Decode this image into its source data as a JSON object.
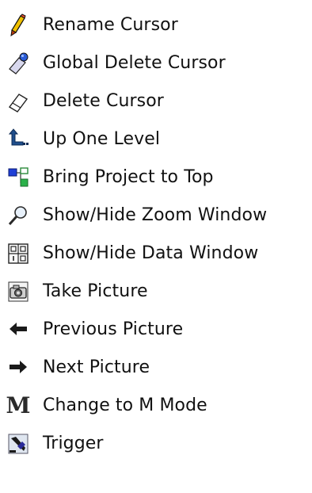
{
  "items": [
    {
      "icon": "pencil-icon",
      "label": "Rename Cursor"
    },
    {
      "icon": "global-delete-cursor-icon",
      "label": "Global Delete Cursor"
    },
    {
      "icon": "eraser-icon",
      "label": "Delete Cursor"
    },
    {
      "icon": "up-one-level-icon",
      "label": "Up One Level"
    },
    {
      "icon": "bring-project-to-top-icon",
      "label": "Bring Project to Top"
    },
    {
      "icon": "magnifier-icon",
      "label": "Show/Hide Zoom Window"
    },
    {
      "icon": "data-window-icon",
      "label": "Show/Hide Data Window"
    },
    {
      "icon": "camera-icon",
      "label": "Take Picture"
    },
    {
      "icon": "arrow-left-icon",
      "label": "Previous Picture"
    },
    {
      "icon": "arrow-right-icon",
      "label": "Next Picture"
    },
    {
      "icon": "m-mode-icon",
      "label": "Change to M Mode",
      "glyph": "M"
    },
    {
      "icon": "trigger-icon",
      "label": "Trigger"
    }
  ]
}
